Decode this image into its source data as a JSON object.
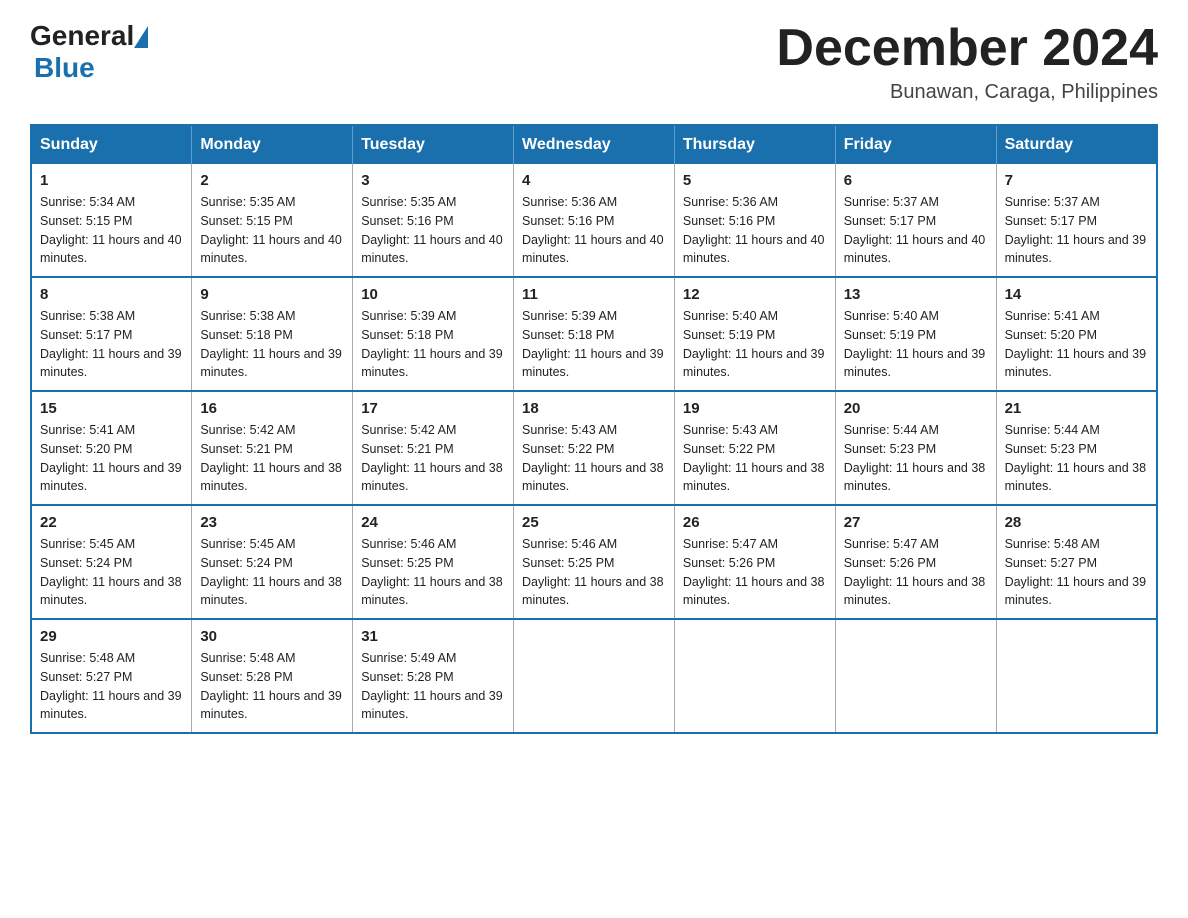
{
  "logo": {
    "general": "General",
    "blue": "Blue"
  },
  "title": "December 2024",
  "location": "Bunawan, Caraga, Philippines",
  "days_of_week": [
    "Sunday",
    "Monday",
    "Tuesday",
    "Wednesday",
    "Thursday",
    "Friday",
    "Saturday"
  ],
  "weeks": [
    [
      {
        "day": "1",
        "sunrise": "5:34 AM",
        "sunset": "5:15 PM",
        "daylight": "11 hours and 40 minutes."
      },
      {
        "day": "2",
        "sunrise": "5:35 AM",
        "sunset": "5:15 PM",
        "daylight": "11 hours and 40 minutes."
      },
      {
        "day": "3",
        "sunrise": "5:35 AM",
        "sunset": "5:16 PM",
        "daylight": "11 hours and 40 minutes."
      },
      {
        "day": "4",
        "sunrise": "5:36 AM",
        "sunset": "5:16 PM",
        "daylight": "11 hours and 40 minutes."
      },
      {
        "day": "5",
        "sunrise": "5:36 AM",
        "sunset": "5:16 PM",
        "daylight": "11 hours and 40 minutes."
      },
      {
        "day": "6",
        "sunrise": "5:37 AM",
        "sunset": "5:17 PM",
        "daylight": "11 hours and 40 minutes."
      },
      {
        "day": "7",
        "sunrise": "5:37 AM",
        "sunset": "5:17 PM",
        "daylight": "11 hours and 39 minutes."
      }
    ],
    [
      {
        "day": "8",
        "sunrise": "5:38 AM",
        "sunset": "5:17 PM",
        "daylight": "11 hours and 39 minutes."
      },
      {
        "day": "9",
        "sunrise": "5:38 AM",
        "sunset": "5:18 PM",
        "daylight": "11 hours and 39 minutes."
      },
      {
        "day": "10",
        "sunrise": "5:39 AM",
        "sunset": "5:18 PM",
        "daylight": "11 hours and 39 minutes."
      },
      {
        "day": "11",
        "sunrise": "5:39 AM",
        "sunset": "5:18 PM",
        "daylight": "11 hours and 39 minutes."
      },
      {
        "day": "12",
        "sunrise": "5:40 AM",
        "sunset": "5:19 PM",
        "daylight": "11 hours and 39 minutes."
      },
      {
        "day": "13",
        "sunrise": "5:40 AM",
        "sunset": "5:19 PM",
        "daylight": "11 hours and 39 minutes."
      },
      {
        "day": "14",
        "sunrise": "5:41 AM",
        "sunset": "5:20 PM",
        "daylight": "11 hours and 39 minutes."
      }
    ],
    [
      {
        "day": "15",
        "sunrise": "5:41 AM",
        "sunset": "5:20 PM",
        "daylight": "11 hours and 39 minutes."
      },
      {
        "day": "16",
        "sunrise": "5:42 AM",
        "sunset": "5:21 PM",
        "daylight": "11 hours and 38 minutes."
      },
      {
        "day": "17",
        "sunrise": "5:42 AM",
        "sunset": "5:21 PM",
        "daylight": "11 hours and 38 minutes."
      },
      {
        "day": "18",
        "sunrise": "5:43 AM",
        "sunset": "5:22 PM",
        "daylight": "11 hours and 38 minutes."
      },
      {
        "day": "19",
        "sunrise": "5:43 AM",
        "sunset": "5:22 PM",
        "daylight": "11 hours and 38 minutes."
      },
      {
        "day": "20",
        "sunrise": "5:44 AM",
        "sunset": "5:23 PM",
        "daylight": "11 hours and 38 minutes."
      },
      {
        "day": "21",
        "sunrise": "5:44 AM",
        "sunset": "5:23 PM",
        "daylight": "11 hours and 38 minutes."
      }
    ],
    [
      {
        "day": "22",
        "sunrise": "5:45 AM",
        "sunset": "5:24 PM",
        "daylight": "11 hours and 38 minutes."
      },
      {
        "day": "23",
        "sunrise": "5:45 AM",
        "sunset": "5:24 PM",
        "daylight": "11 hours and 38 minutes."
      },
      {
        "day": "24",
        "sunrise": "5:46 AM",
        "sunset": "5:25 PM",
        "daylight": "11 hours and 38 minutes."
      },
      {
        "day": "25",
        "sunrise": "5:46 AM",
        "sunset": "5:25 PM",
        "daylight": "11 hours and 38 minutes."
      },
      {
        "day": "26",
        "sunrise": "5:47 AM",
        "sunset": "5:26 PM",
        "daylight": "11 hours and 38 minutes."
      },
      {
        "day": "27",
        "sunrise": "5:47 AM",
        "sunset": "5:26 PM",
        "daylight": "11 hours and 38 minutes."
      },
      {
        "day": "28",
        "sunrise": "5:48 AM",
        "sunset": "5:27 PM",
        "daylight": "11 hours and 39 minutes."
      }
    ],
    [
      {
        "day": "29",
        "sunrise": "5:48 AM",
        "sunset": "5:27 PM",
        "daylight": "11 hours and 39 minutes."
      },
      {
        "day": "30",
        "sunrise": "5:48 AM",
        "sunset": "5:28 PM",
        "daylight": "11 hours and 39 minutes."
      },
      {
        "day": "31",
        "sunrise": "5:49 AM",
        "sunset": "5:28 PM",
        "daylight": "11 hours and 39 minutes."
      },
      null,
      null,
      null,
      null
    ]
  ]
}
